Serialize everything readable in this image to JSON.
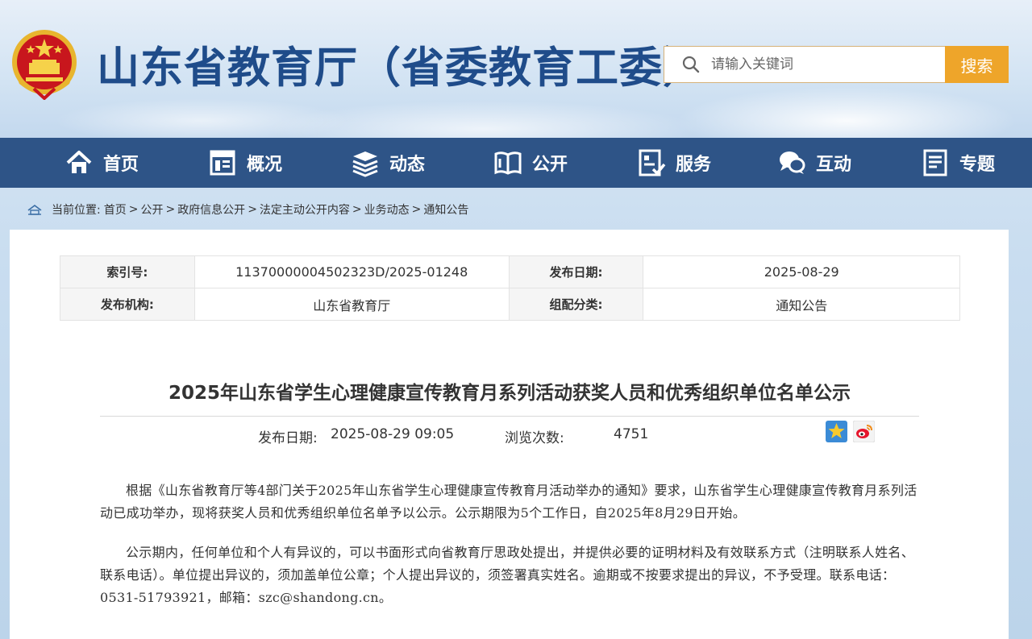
{
  "header": {
    "site_title": "山东省教育厅（省委教育工委）",
    "search_placeholder": "请输入关键词",
    "search_button": "搜索"
  },
  "nav": {
    "items": [
      {
        "label": "首页",
        "icon": "home-icon"
      },
      {
        "label": "概况",
        "icon": "overview-icon"
      },
      {
        "label": "动态",
        "icon": "news-icon"
      },
      {
        "label": "公开",
        "icon": "book-icon"
      },
      {
        "label": "服务",
        "icon": "service-icon"
      },
      {
        "label": "互动",
        "icon": "chat-icon"
      },
      {
        "label": "专题",
        "icon": "topic-icon"
      }
    ]
  },
  "breadcrumb": {
    "prefix": "当前位置:",
    "items": [
      "首页",
      "公开",
      "政府信息公开",
      "法定主动公开内容",
      "业务动态",
      "通知公告"
    ],
    "separator": ">"
  },
  "meta": {
    "index_label": "索引号:",
    "index_value": "11370000004502323D/2025-01248",
    "date_label": "发布日期:",
    "date_value": "2025-08-29",
    "org_label": "发布机构:",
    "org_value": "山东省教育厅",
    "category_label": "组配分类:",
    "category_value": "通知公告"
  },
  "article": {
    "title": "2025年山东省学生心理健康宣传教育月系列活动获奖人员和优秀组织单位名单公示",
    "publish_label": "发布日期:",
    "publish_value": "2025-08-29 09:05",
    "views_label": "浏览次数:",
    "views_value": "4751",
    "paragraph1": "根据《山东省教育厅等4部门关于2025年山东省学生心理健康宣传教育月活动举办的通知》要求，山东省学生心理健康宣传教育月系列活动已成功举办，现将获奖人员和优秀组织单位名单予以公示。公示期限为5个工作日，自2025年8月29日开始。",
    "paragraph2": "公示期内，任何单位和个人有异议的，可以书面形式向省教育厅思政处提出，并提供必要的证明材料及有效联系方式（注明联系人姓名、联系电话）。单位提出异议的，须加盖单位公章；个人提出异议的，须签署真实姓名。逾期或不按要求提出的异议，不予受理。联系电话：0531-51793921，邮箱：szc@shandong.cn。"
  },
  "colors": {
    "nav_bg": "#2e5487",
    "title_blue": "#1f4c8a",
    "search_orange": "#eea52a"
  }
}
